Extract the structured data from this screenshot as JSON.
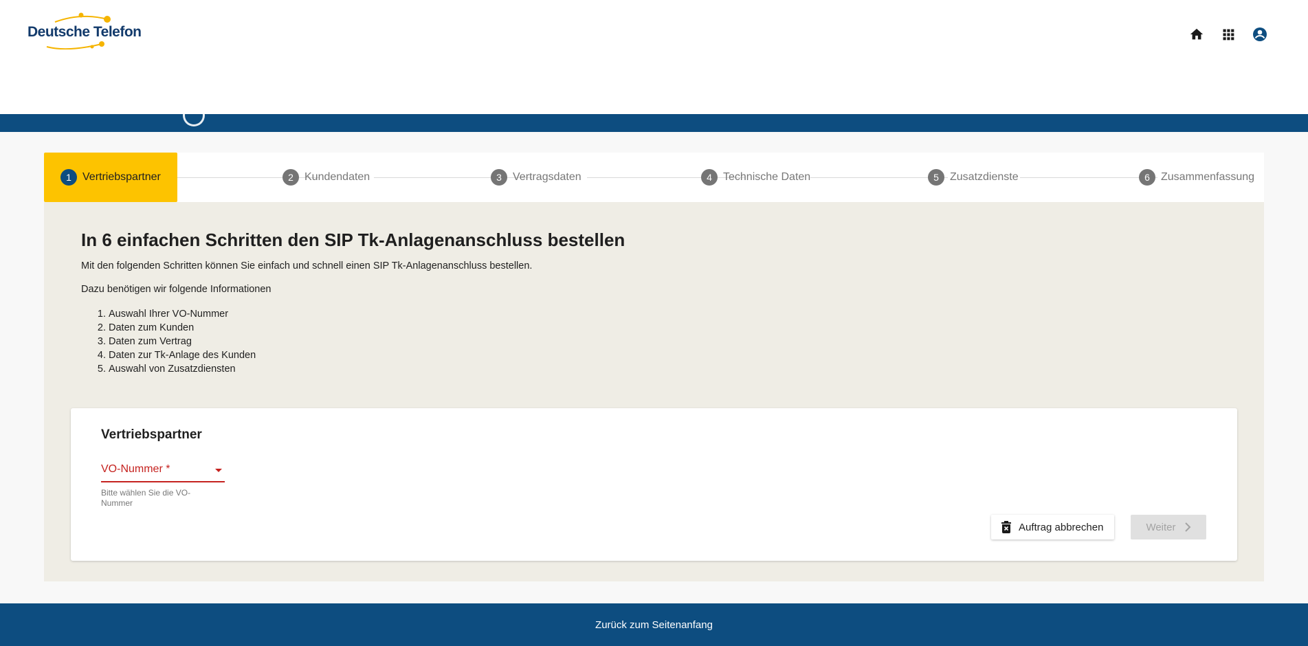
{
  "header": {
    "logo_text": "Deutsche Telefon",
    "icons": [
      "home-icon",
      "apps-grid-icon",
      "account-icon"
    ]
  },
  "stepper": {
    "steps": [
      {
        "num": "1",
        "label": "Vertriebspartner",
        "active": true
      },
      {
        "num": "2",
        "label": "Kundendaten",
        "active": false
      },
      {
        "num": "3",
        "label": "Vertragsdaten",
        "active": false
      },
      {
        "num": "4",
        "label": "Technische Daten",
        "active": false
      },
      {
        "num": "5",
        "label": "Zusatzdienste",
        "active": false
      },
      {
        "num": "6",
        "label": "Zusammenfassung",
        "active": false
      }
    ]
  },
  "intro": {
    "title": "In 6 einfachen Schritten den SIP Tk-Anlagenanschluss bestellen",
    "para1": "Mit den folgenden Schritten können Sie einfach und schnell einen SIP Tk-Anlagenanschluss bestellen.",
    "para2": "Dazu benötigen wir folgende Informationen",
    "list": [
      "Auswahl Ihrer VO-Nummer",
      "Daten zum Kunden",
      "Daten zum Vertrag",
      "Daten zur Tk-Anlage des Kunden",
      "Auswahl von Zusatzdiensten"
    ]
  },
  "card": {
    "title": "Vertriebspartner",
    "select_label": "VO-Nummer *",
    "select_hint": "Bitte wählen Sie die VO-Nummer",
    "cancel_label": "Auftrag abbrechen",
    "next_label": "Weiter"
  },
  "footer": {
    "back_to_top": "Zurück zum Seitenanfang"
  },
  "colors": {
    "brand_blue": "#0d4d80",
    "accent_yellow": "#fdc300",
    "error_red": "#c5221f",
    "content_bg": "#efede5"
  }
}
